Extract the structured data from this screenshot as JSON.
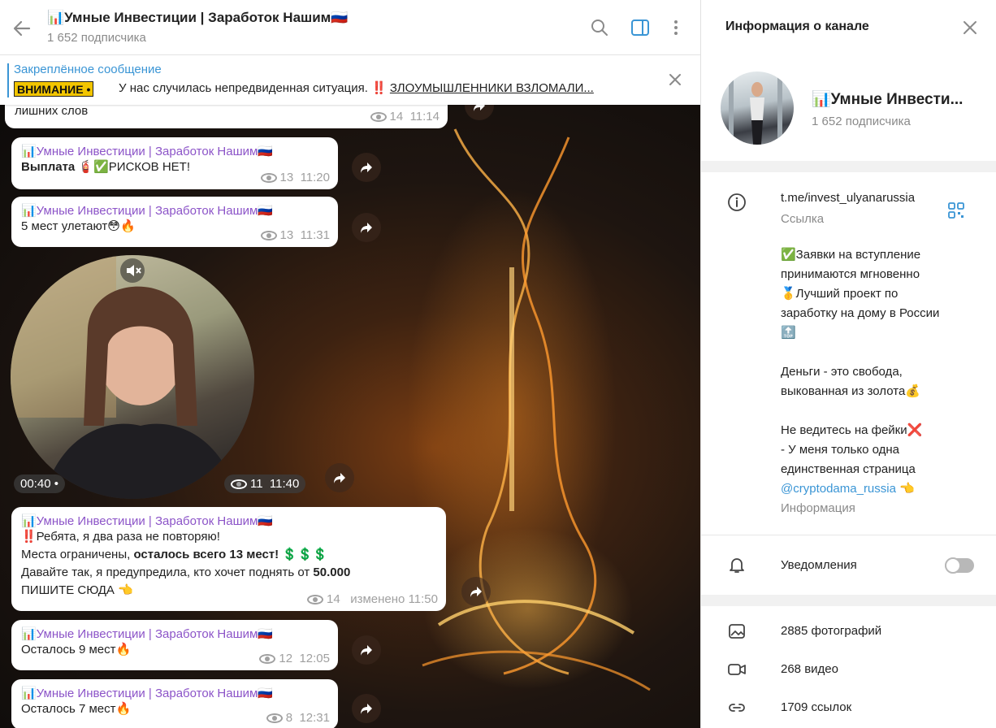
{
  "header": {
    "title": "📊Умные Инвестиции | Заработок Нашим🇷🇺",
    "subscribers": "1 652 подписчика"
  },
  "pinned": {
    "title": "Закреплённое сообщение",
    "badge": "ВНИМАНИЕ •",
    "text": "У нас случилась непредвиденная ситуация. ‼️ ",
    "link": "ЗЛОУМЫШЛЕННИКИ ВЗЛОМАЛИ..."
  },
  "messages": [
    {
      "text": "лишних слов",
      "views": "14",
      "time": "11:14"
    },
    {
      "name": "📊Умные Инвестиции | Заработок Нашим🇷🇺",
      "text": "Выплата 🧯✅РИСКОВ НЕТ!",
      "bold": "Выплата",
      "rest": " 🧯✅РИСКОВ НЕТ!",
      "views": "13",
      "time": "11:20"
    },
    {
      "name": "📊Умные Инвестиции | Заработок Нашим🇷🇺",
      "text": "5 мест улетают😳🔥",
      "views": "13",
      "time": "11:31"
    },
    {
      "name": "📊Умные Инвестиции | Заработок Нашим🇷🇺",
      "line1": "‼️Ребята, я два раза не повторяю!",
      "line2a": "Места ограничены, ",
      "line2b": "осталось всего 13 мест!",
      "line2c": " 💲💲💲",
      "line3a": "Давайте так, я предупредила, кто хочет поднять от ",
      "line3b": "50.000",
      "line4": "ПИШИТЕ СЮДА 👈",
      "views": "14",
      "time": "изменено 11:50"
    },
    {
      "name": "📊Умные Инвестиции | Заработок Нашим🇷🇺",
      "text": "Осталось 9 мест🔥",
      "views": "12",
      "time": "12:05"
    },
    {
      "name": "📊Умные Инвестиции | Заработок Нашим🇷🇺",
      "text": "Осталось 7 мест🔥",
      "views": "8",
      "time": "12:31"
    }
  ],
  "video": {
    "duration": "00:40 •",
    "views": "11",
    "time": "11:40"
  },
  "panel": {
    "title": "Информация о канале",
    "name": "📊Умные Инвести...",
    "subscribers": "1 652 подписчика",
    "link": "t.me/invest_ulyanarussia",
    "link_label": "Ссылка",
    "desc": [
      "✅Заявки на вступление",
      "принимаются мгновенно",
      "🥇Лучший проект по",
      "заработку на дому в России",
      "🔝",
      "",
      "Деньги - это свобода,",
      "выкованная из золота💰",
      "",
      "Не ведитесь на фейки❌",
      "- У меня только одна",
      "единственная страница"
    ],
    "desc_link": "@cryptodama_russia",
    "desc_link_suffix": " 👈",
    "info_label": "Информация",
    "notifications": "Уведомления",
    "photos": "2885 фотографий",
    "videos": "268 видео",
    "links": "1709 ссылок"
  },
  "colors": {
    "accent": "#3a95d5",
    "channel_name": "#8c54c8",
    "muted": "#8a8a8a"
  }
}
